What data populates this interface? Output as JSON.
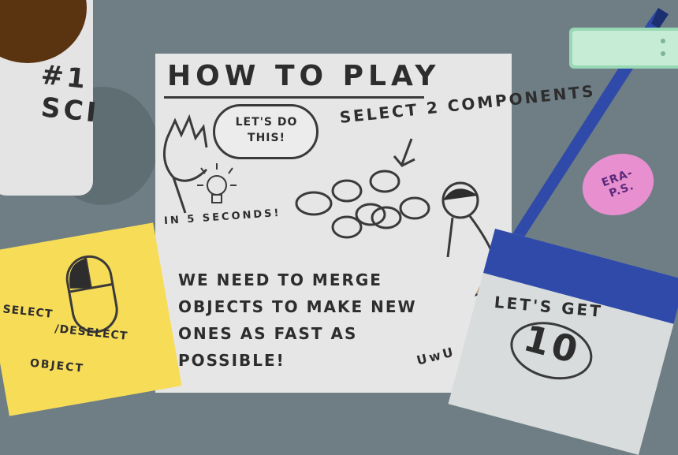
{
  "mug": {
    "text_line1": "#1",
    "text_line2": "SCI"
  },
  "paper": {
    "title": "HOW TO PLAY",
    "speech_bubble": "LET'S DO THIS!",
    "select_instruction": "SELECT 2 COMPONENTS",
    "timer_note": "IN 5 SECONDS!",
    "body_text": "WE NEED TO MERGE OBJECTS TO MAKE NEW ONES AS FAST AS POSSIBLE!",
    "signature": "UwU"
  },
  "sticky_note": {
    "line1": "SELECT",
    "line2": "/DESELECT",
    "line3": "OBJECT"
  },
  "calendar": {
    "text": "LET'S GET",
    "number": "10"
  },
  "eraser": {
    "text": "ERA- P.S."
  },
  "colors": {
    "table": "#6e7e84",
    "paper": "#e6e6e6",
    "sticky": "#f7dc58",
    "calendar": "#2f4aa8",
    "pencil": "#2f4aa8",
    "eraser": "#e88fd0",
    "clock": "#98d8b4",
    "coffee": "#5a3310"
  }
}
